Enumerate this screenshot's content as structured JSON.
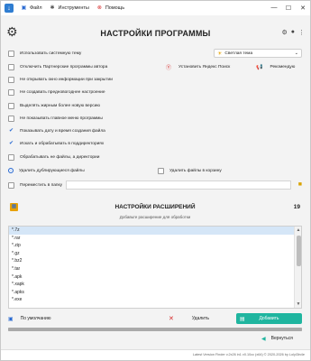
{
  "menu": {
    "file": "Файл",
    "tools": "Инструменты",
    "help": "Помощь"
  },
  "page_title": "НАСТРОЙКИ ПРОГРАММЫ",
  "theme": {
    "selected": "Светлая тема"
  },
  "options": {
    "use_system_theme": "Использовать системную тему",
    "disable_partner": "Отключить Партнерские программы автора",
    "no_info_on_close": "Не открывать окно информации при закрытии",
    "no_holiday_mood": "Не создавать предновогоднее настроение",
    "bold_new_version": "Выделять жирным более новую версию",
    "hide_main_menu": "Не показывать главное меню программы",
    "show_date_time": "Показывать дату и время создания файла",
    "search_subdirs": "Искать и обрабатывать в поддиректориях",
    "process_files_dirs": "Обрабатывать не файлы, а директории",
    "delete_duplicates": "Удалить дублирующиеся файлы",
    "delete_to_recycle": "Удалить файлы в корзину",
    "move_to_folder": "Переместить в папку"
  },
  "links": {
    "install_yandex": "Установить Яндекс Поиск",
    "recommend": "Рекомендую"
  },
  "extensions": {
    "title": "НАСТРОЙКИ РАСШИРЕНИЙ",
    "subtitle": "Добавьте расширение для обработки",
    "count": "19",
    "items": [
      "*.7z",
      "*.rar",
      "*.zip",
      "*.gz",
      "*.bz2",
      "*.tar",
      "*.apk",
      "*.xapk",
      "*.apks",
      "*.exe"
    ]
  },
  "actions": {
    "default": "По умолчанию",
    "delete": "Удалить",
    "add": "Добавить",
    "back": "Вернуться"
  },
  "progress": 1.0,
  "footer": "Latest Version Finder v.2x26 in1 v0.10cc (x64) © 2020-2026 by Lolyi3in4e",
  "colors": {
    "accent": "#2a6ad1",
    "add_button": "#1fb59f",
    "delete_icon": "#d62b2b",
    "folder_icon": "#d9a300"
  }
}
